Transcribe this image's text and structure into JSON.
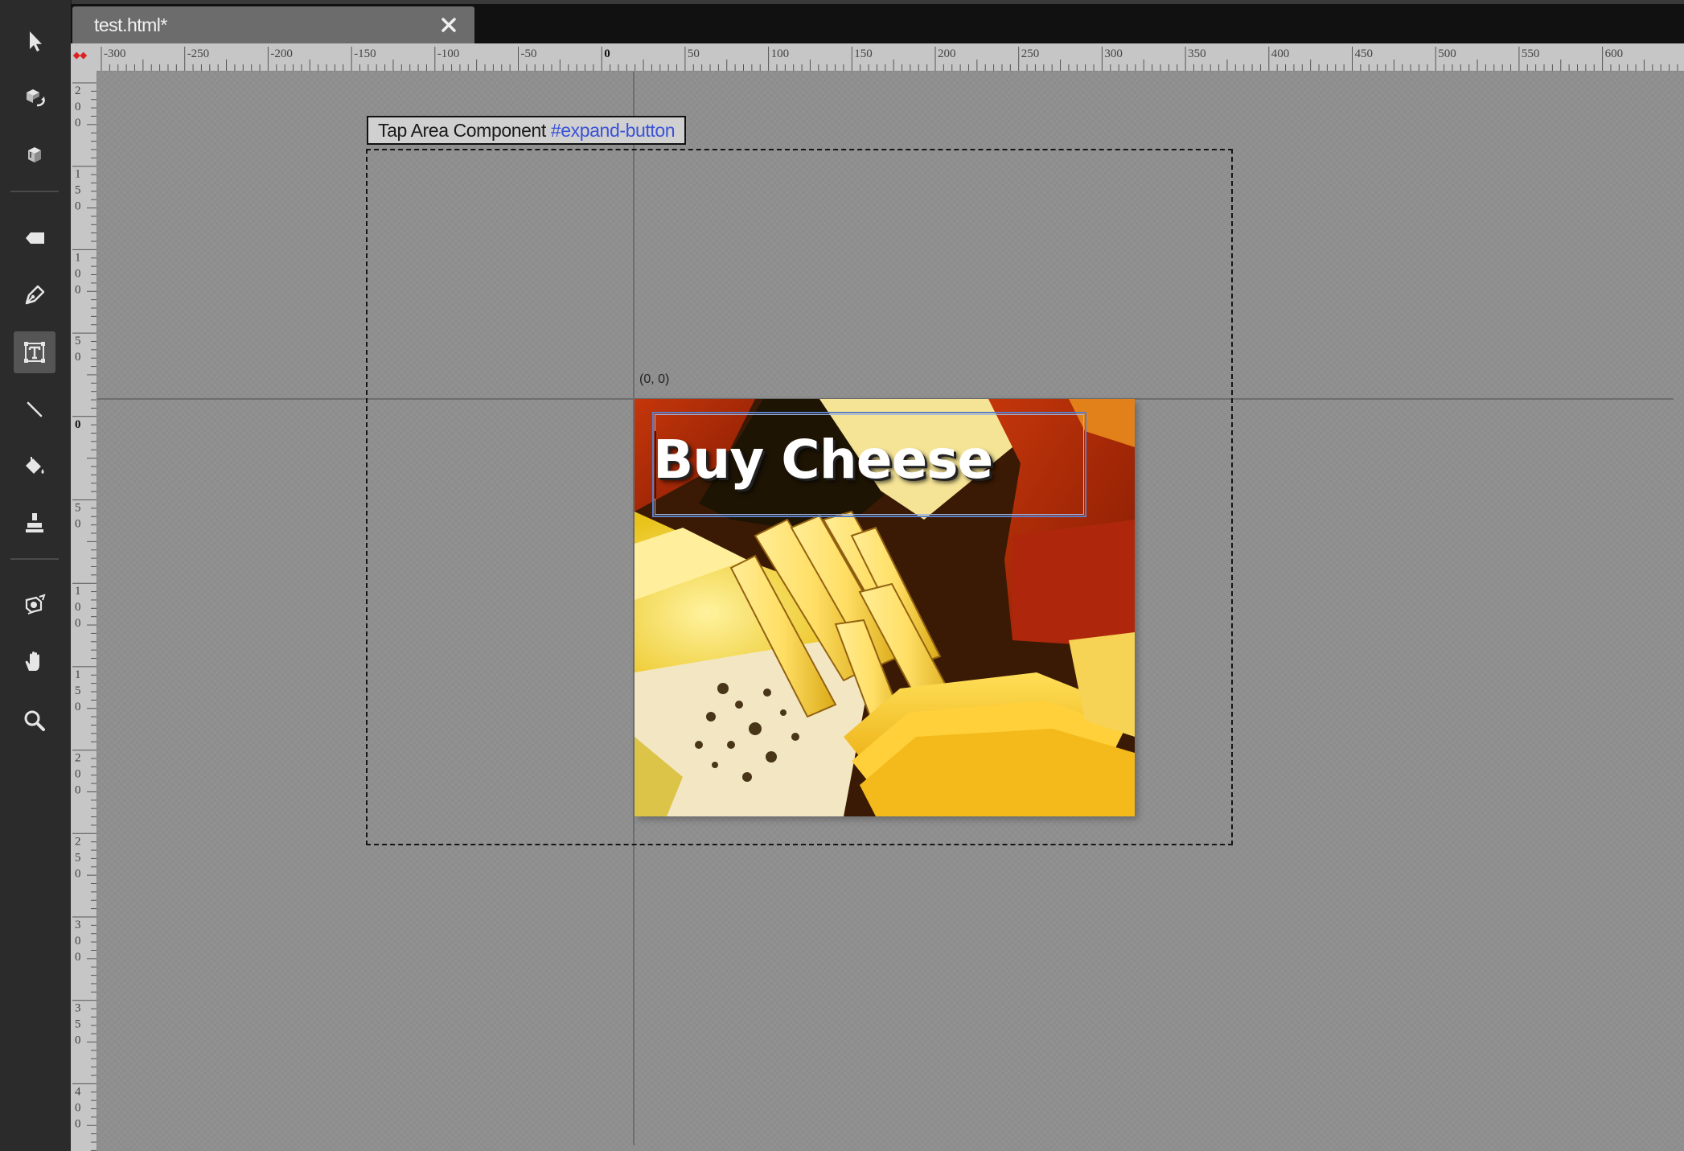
{
  "toolbar": {
    "tools": [
      {
        "icon": "select-arrow-icon"
      },
      {
        "icon": "3d-rotate-icon"
      },
      {
        "icon": "3d-translate-icon"
      },
      {
        "icon": "eraser-icon"
      },
      {
        "icon": "pen-icon"
      },
      {
        "icon": "text-tool-icon",
        "active": true
      },
      {
        "icon": "line-tool-icon"
      },
      {
        "icon": "paint-bucket-icon"
      },
      {
        "icon": "stamp-icon"
      },
      {
        "icon": "camera-icon"
      },
      {
        "icon": "hand-icon"
      },
      {
        "icon": "zoom-icon"
      }
    ]
  },
  "tab": {
    "title": "test.html*"
  },
  "rulers": {
    "horizontal_ticks": [
      "-300",
      "-250",
      "-200",
      "-150",
      "-100",
      "-50",
      "0",
      "50",
      "100",
      "150",
      "200",
      "250",
      "300",
      "350",
      "400",
      "450",
      "500",
      "550",
      "600"
    ],
    "vertical_ticks": [
      "200",
      "150",
      "100",
      "50",
      "0",
      "50",
      "100",
      "150",
      "200",
      "250",
      "300",
      "350",
      "400"
    ]
  },
  "stage": {
    "origin_label": "(0, 0)",
    "tap_area": {
      "label": "Tap Area Component",
      "id": "#expand-button"
    },
    "ad": {
      "headline": "Buy Cheese"
    }
  },
  "colors": {
    "canvas": "#8d8d8d",
    "toolbar": "#2b2b2b",
    "ruler": "#c6c6c6",
    "link_blue": "#3a52d8",
    "selection_blue": "#5a7fc8"
  }
}
